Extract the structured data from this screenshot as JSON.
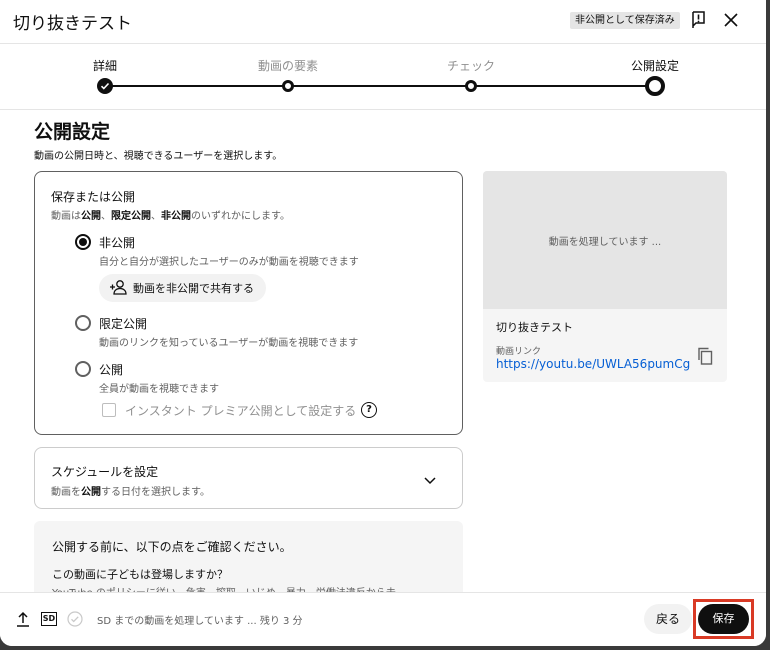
{
  "header": {
    "title": "切り抜きテスト",
    "draft_badge": "非公開として保存済み",
    "icons": {
      "feedback": "feedback-icon",
      "close": "close-icon"
    }
  },
  "stepper": {
    "steps": [
      {
        "label": "詳細",
        "state": "done"
      },
      {
        "label": "動画の要素",
        "state": "pending"
      },
      {
        "label": "チェック",
        "state": "pending"
      },
      {
        "label": "公開設定",
        "state": "active"
      }
    ]
  },
  "main": {
    "title": "公開設定",
    "subtitle": "動画の公開日時と、視聴できるユーザーを選択します。"
  },
  "visibility": {
    "title": "保存または公開",
    "desc_parts": [
      "動画は",
      "公開",
      "、",
      "限定公開",
      "、",
      "非公開",
      "のいずれかにします。"
    ],
    "options": [
      {
        "label": "非公開",
        "desc": "自分と自分が選択したユーザーのみが動画を視聴できます",
        "selected": true
      },
      {
        "label": "限定公開",
        "desc": "動画のリンクを知っているユーザーが動画を視聴できます",
        "selected": false
      },
      {
        "label": "公開",
        "desc": "全員が動画を視聴できます",
        "selected": false
      }
    ],
    "share_label": "動画を非公開で共有する",
    "premiere_label": "インスタント プレミア公開として設定する",
    "help_glyph": "?"
  },
  "schedule": {
    "title": "スケジュールを設定",
    "desc_parts": [
      "動画を",
      "公開",
      "する日付を選択します。"
    ]
  },
  "checklist": {
    "title": "公開する前に、以下の点をご確認ください。",
    "question": "この動画に子どもは登場しますか？",
    "body": "YouTube のポリシーに従い、危害、搾取、いじめ、暴力、労働法違反から未"
  },
  "preview": {
    "processing": "動画を処理しています ...",
    "video_title": "切り抜きテスト",
    "link_label": "動画リンク",
    "link": "https://youtu.be/UWLA56pumCg"
  },
  "footer": {
    "sd_label": "SD",
    "status": "SD までの動画を処理しています ... 残り 3 分",
    "back_label": "戻る",
    "save_label": "保存"
  },
  "colors": {
    "accent": "#0f0f0f",
    "link": "#065fd4",
    "highlight": "#d93a25"
  }
}
